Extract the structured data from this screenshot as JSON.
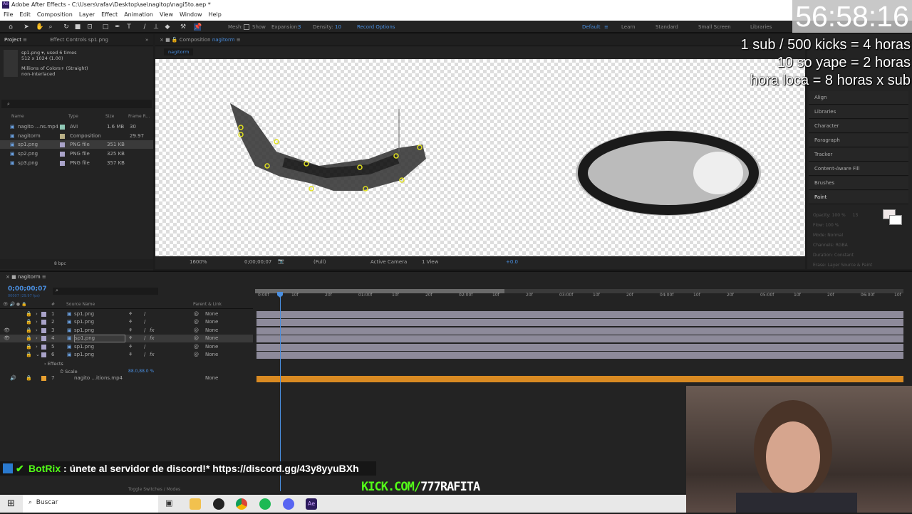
{
  "window": {
    "title": "Adobe After Effects - C:\\Users\\rafav\\Desktop\\ae\\nagitop\\nagi5to.aep *",
    "app_icon": "Ae"
  },
  "menu": [
    "File",
    "Edit",
    "Composition",
    "Layer",
    "Effect",
    "Animation",
    "View",
    "Window",
    "Help"
  ],
  "toolbar": {
    "mesh_label": "Mesh:",
    "show_label": "Show",
    "expansion_label": "Expansion:",
    "expansion_value": "3",
    "density_label": "Density:",
    "density_value": "10",
    "record_options": "Record Options",
    "workspaces": [
      "Default",
      "Learn",
      "Standard",
      "Small Screen",
      "Libraries"
    ],
    "active_workspace": "Default"
  },
  "project": {
    "tab": "Project",
    "effect_controls_tab": "Effect Controls sp1.png",
    "selected_name": "sp1.png",
    "used": ", used 6 times",
    "dimensions": "512 x 1024 (1.00)",
    "colors": "Millions of Colors+ (Straight)",
    "interlace": "non-interlaced",
    "columns": [
      "Name",
      "Type",
      "Size",
      "Frame R..."
    ],
    "items": [
      {
        "name": "nagito ...ns.mp4",
        "type": "AVI",
        "size": "1.6 MB",
        "frame_rate": "30",
        "color": "#8fc7b5"
      },
      {
        "name": "nagitorm",
        "type": "Composition",
        "size": "",
        "frame_rate": "29.97",
        "color": "#b7ae85"
      },
      {
        "name": "sp1.png",
        "type": "PNG file",
        "size": "351 KB",
        "frame_rate": "",
        "color": "#a9a3c9",
        "selected": true
      },
      {
        "name": "sp2.png",
        "type": "PNG file",
        "size": "325 KB",
        "frame_rate": "",
        "color": "#a9a3c9"
      },
      {
        "name": "sp3.png",
        "type": "PNG file",
        "size": "357 KB",
        "frame_rate": "",
        "color": "#a9a3c9"
      }
    ],
    "bit_depth": "8 bpc"
  },
  "composition": {
    "tab_label": "Composition",
    "tab_name": "nagitorm",
    "breadcrumb": "nagitorm",
    "viewer_bar": {
      "zoom": "1600%",
      "timecode": "0;00;00;07",
      "resolution": "(Full)",
      "camera": "Active Camera",
      "views": "1 View",
      "exposure": "+0.0"
    }
  },
  "right_panel": {
    "items": [
      "Align",
      "Libraries",
      "Character",
      "Paragraph",
      "Tracker",
      "Content-Aware Fill",
      "Brushes",
      "Paint"
    ],
    "paint": {
      "opacity_label": "Opacity:",
      "opacity": "100 %",
      "flow_label": "Flow:",
      "flow": "100 %",
      "brush_size": "13",
      "mode_label": "Mode:",
      "mode": "Normal",
      "channels_label": "Channels:",
      "channels": "RGBA",
      "duration_label": "Duration:",
      "duration": "Constant",
      "erase_label": "Erase:",
      "erase": "Layer Source & Paint"
    }
  },
  "timeline": {
    "tab": "nagitorm",
    "timecode": "0;00;00;07",
    "frame_info": "00007 (29.97 fps)",
    "columns": {
      "num": "#",
      "source": "Source Name",
      "parent": "Parent & Link"
    },
    "layers": [
      {
        "num": "1",
        "name": "sp1.png",
        "fx": false,
        "visible": false,
        "parent": "None"
      },
      {
        "num": "2",
        "name": "sp1.png",
        "fx": false,
        "visible": false,
        "parent": "None"
      },
      {
        "num": "3",
        "name": "sp1.png",
        "fx": true,
        "visible": true,
        "parent": "None"
      },
      {
        "num": "4",
        "name": "sp1.png",
        "fx": true,
        "visible": true,
        "parent": "None",
        "selected": true
      },
      {
        "num": "5",
        "name": "sp1.png",
        "fx": false,
        "visible": false,
        "parent": "None"
      },
      {
        "num": "6",
        "name": "sp1.png",
        "fx": true,
        "visible": false,
        "parent": "None",
        "expanded": true
      }
    ],
    "effects_label": "Effects",
    "scale_label": "Scale",
    "scale_value": "88.0,88.0 %",
    "layer7": {
      "num": "7",
      "name": "nagito ...itions.mp4",
      "parent": "None",
      "color": "#e8a030"
    },
    "ruler": [
      "0:00f",
      "10f",
      "20f",
      "01:00f",
      "10f",
      "20f",
      "02:00f",
      "10f",
      "20f",
      "03:00f",
      "10f",
      "20f",
      "04:00f",
      "10f",
      "20f",
      "05:00f",
      "10f",
      "20f",
      "06:00f",
      "10f"
    ],
    "footer": "Toggle Switches / Modes"
  },
  "stream_overlay": {
    "timer": "56:58:16",
    "lines": [
      "1 sub / 500 kicks = 4 horas",
      "10 so yape = 2 horas",
      "hora loca = 8 horas x sub"
    ],
    "chat_user": "BotRix",
    "chat_message": " : únete al servidor de discord!* https://discord.gg/43y8yyuBXh",
    "kick": "KICK.COM/",
    "kick_user": "777RAFITA"
  },
  "taskbar": {
    "search": "Buscar"
  }
}
